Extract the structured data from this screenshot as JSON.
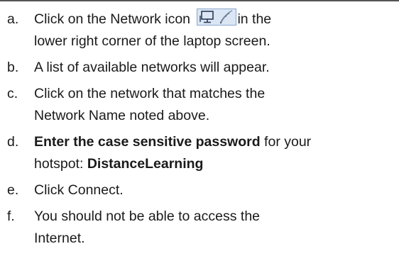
{
  "steps": [
    {
      "letter": "a.",
      "text_before_icon": "Click on the Network icon",
      "icon": "network-wifi-icon",
      "text_after_icon": "in the",
      "line2": "lower right corner of the laptop screen."
    },
    {
      "letter": "b.",
      "text": "A list of available networks will appear."
    },
    {
      "letter": "c.",
      "text": "Click on the network that matches the",
      "line2": "Network Name noted above."
    },
    {
      "letter": "d.",
      "bold_text": "Enter the case sensitive password",
      "text": " for your",
      "line2_prefix": "hotspot: ",
      "line2_bold": "DistanceLearning"
    },
    {
      "letter": "e.",
      "text": "Click Connect."
    },
    {
      "letter": "f.",
      "text": "You should not be able to access the",
      "line2": "Internet."
    }
  ],
  "colors": {
    "text": "#1a1a1a",
    "rule": "#555555",
    "icon_bg": "#dbe6f4",
    "icon_border": "#8aa6cc"
  }
}
